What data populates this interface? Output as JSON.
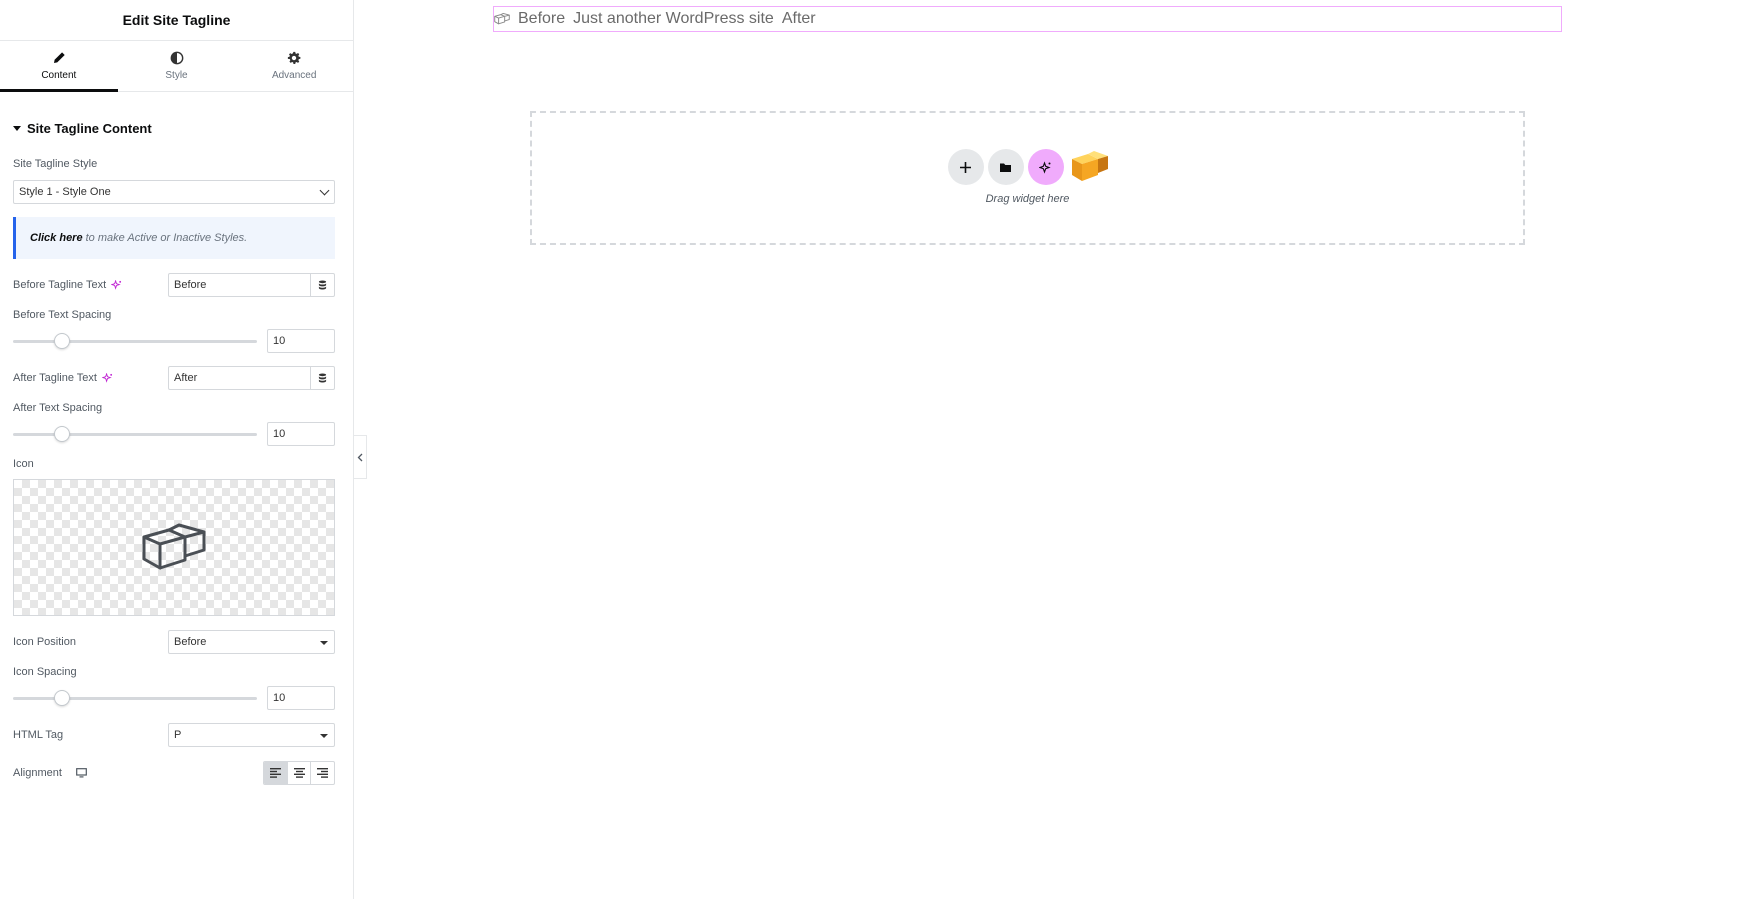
{
  "panel": {
    "title": "Edit Site Tagline",
    "tabs": [
      {
        "label": "Content",
        "icon": "pencil-icon",
        "active": true
      },
      {
        "label": "Style",
        "icon": "half-circle-icon",
        "active": false
      },
      {
        "label": "Advanced",
        "icon": "gear-icon",
        "active": false
      }
    ],
    "section_title": "Site Tagline Content",
    "tagline_style": {
      "label": "Site Tagline Style",
      "value": "Style 1 - Style One"
    },
    "notice": {
      "link": "Click here",
      "text": "to make Active or Inactive Styles."
    },
    "before_text": {
      "label": "Before Tagline Text",
      "value": "Before"
    },
    "before_spacing": {
      "label": "Before Text Spacing",
      "value": "10",
      "level": 0.2
    },
    "after_text": {
      "label": "After Tagline Text",
      "value": "After"
    },
    "after_spacing": {
      "label": "After Text Spacing",
      "value": "10",
      "level": 0.2
    },
    "icon": {
      "label": "Icon",
      "name": "box-icon"
    },
    "icon_position": {
      "label": "Icon Position",
      "value": "Before"
    },
    "icon_spacing": {
      "label": "Icon Spacing",
      "value": "10",
      "level": 0.2
    },
    "html_tag": {
      "label": "HTML Tag",
      "value": "P"
    },
    "alignment": {
      "label": "Alignment",
      "options": [
        "left",
        "center",
        "right"
      ],
      "selected": "left"
    }
  },
  "canvas": {
    "tagline": {
      "before": "Before",
      "text": "Just another WordPress site",
      "after": "After"
    },
    "dropzone": {
      "text": "Drag widget here"
    }
  },
  "colors": {
    "accent_pink": "#f0abfc",
    "notice_border": "#2563eb",
    "logo_orange": "#f5a623"
  }
}
